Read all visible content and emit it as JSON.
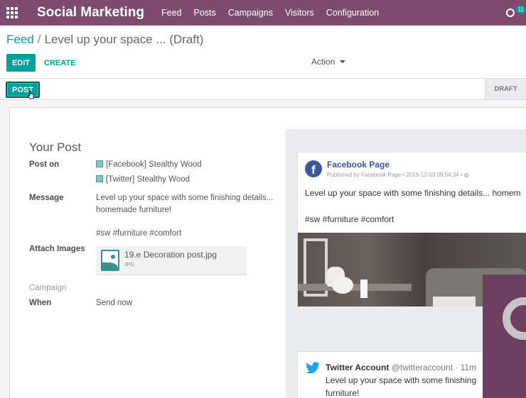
{
  "navbar": {
    "app_title": "Social Marketing",
    "menu": [
      "Feed",
      "Posts",
      "Campaigns",
      "Visitors",
      "Configuration"
    ],
    "badge": "11"
  },
  "breadcrumb": {
    "parent": "Feed",
    "separator": "/",
    "current": "Level up your space ... (Draft)"
  },
  "toolbar": {
    "edit_label": "EDIT",
    "create_label": "CREATE",
    "action_label": "Action"
  },
  "statusbar": {
    "post_label": "POST",
    "status": "DRAFT"
  },
  "form": {
    "section_title": "Your Post",
    "post_on_label": "Post on",
    "accounts": [
      "[Facebook] Stealthy Wood",
      "[Twitter] Stealthy Wood"
    ],
    "message_label": "Message",
    "message_lines": [
      "Level up your space with some finishing details...",
      "homemade furniture!",
      "#sw #furniture #comfort"
    ],
    "attach_label": "Attach Images",
    "attachment_name": "19.e Decoration post.jpg",
    "attachment_type": "JPG",
    "campaign_label": "Campaign",
    "when_label": "When",
    "when_value": "Send now"
  },
  "preview": {
    "facebook": {
      "page_name": "Facebook Page",
      "meta": "Published by Facebook Page • 2019-12-03 09:54:34 •",
      "text": "Level up your space with some finishing details... homem",
      "tags": "#sw #furniture #comfort"
    },
    "twitter": {
      "account": "Twitter Account",
      "handle": "@twitteraccount · 11m",
      "text_line1": "Level up your space with some finishing",
      "text_line2": "furniture!"
    }
  },
  "colors": {
    "navbar": "#7c4b6e",
    "primary": "#00a09d",
    "facebook": "#3b5998",
    "twitter": "#1da1f2"
  }
}
